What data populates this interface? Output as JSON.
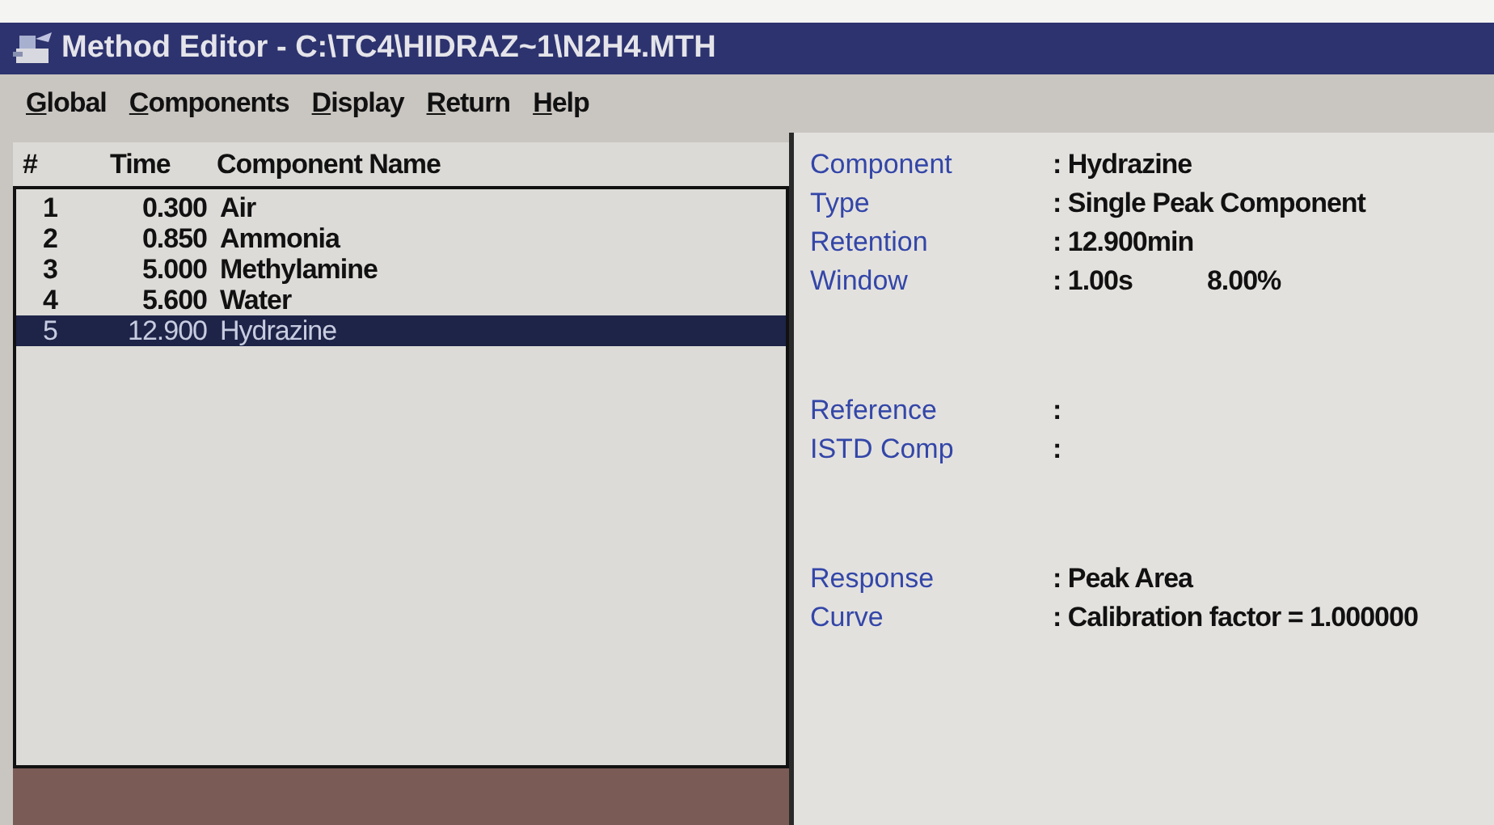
{
  "window": {
    "title": "Method Editor - C:\\TC4\\HIDRAZ~1\\N2H4.MTH"
  },
  "menu": [
    "Global",
    "Components",
    "Display",
    "Return",
    "Help"
  ],
  "table": {
    "columns": [
      "#",
      "Time",
      "Component Name"
    ],
    "rows": [
      {
        "cells": [
          "1",
          "0.300",
          "Air"
        ],
        "selected": false
      },
      {
        "cells": [
          "2",
          "0.850",
          "Ammonia"
        ],
        "selected": false
      },
      {
        "cells": [
          "3",
          "5.000",
          "Methylamine"
        ],
        "selected": false
      },
      {
        "cells": [
          "4",
          "5.600",
          "Water"
        ],
        "selected": false
      },
      {
        "cells": [
          "5",
          "12.900",
          "Hydrazine"
        ],
        "selected": true
      }
    ]
  },
  "details": [
    [
      {
        "label": "Component",
        "values": [
          ": Hydrazine"
        ]
      },
      {
        "label": "Type",
        "values": [
          ": Single Peak Component"
        ]
      },
      {
        "label": "Retention",
        "values": [
          ": 12.900min"
        ]
      },
      {
        "label": "Window",
        "values": [
          ": 1.00s",
          "8.00%"
        ]
      }
    ],
    [
      {
        "label": "Reference",
        "values": [
          ":"
        ]
      },
      {
        "label": "ISTD Comp",
        "values": [
          ":"
        ]
      }
    ],
    [
      {
        "label": "Response",
        "values": [
          ": Peak Area"
        ]
      },
      {
        "label": "Curve",
        "values": [
          ": Calibration factor = 1.000000"
        ]
      }
    ]
  ]
}
